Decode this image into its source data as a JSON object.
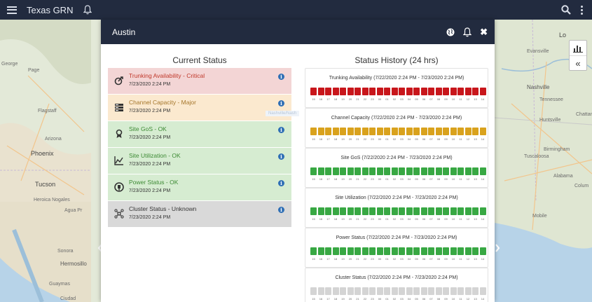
{
  "app": {
    "title": "Texas GRN"
  },
  "map": {
    "labels": [
      {
        "text": "Lo",
        "cls": "map-label big"
      },
      {
        "text": "Evansville",
        "cls": "map-label"
      },
      {
        "text": "Nashville",
        "cls": "map-label city"
      },
      {
        "text": "Tennessee",
        "cls": "map-label"
      },
      {
        "text": "Chattanoog",
        "cls": "map-label"
      },
      {
        "text": "Huntsville",
        "cls": "map-label"
      },
      {
        "text": "Birmingham",
        "cls": "map-label"
      },
      {
        "text": "Tuscaloosa",
        "cls": "map-label"
      },
      {
        "text": "Alabama",
        "cls": "map-label"
      },
      {
        "text": "Colum",
        "cls": "map-label"
      },
      {
        "text": "Mobile",
        "cls": "map-label"
      },
      {
        "text": "George",
        "cls": "map-label"
      },
      {
        "text": "Page",
        "cls": "map-label"
      },
      {
        "text": "Flagstaff",
        "cls": "map-label"
      },
      {
        "text": "Arizona",
        "cls": "map-label"
      },
      {
        "text": "Phoenix",
        "cls": "map-label big"
      },
      {
        "text": "Tucson",
        "cls": "map-label big"
      },
      {
        "text": "Heroica Nogales",
        "cls": "map-label"
      },
      {
        "text": "Agua Pr",
        "cls": "map-label"
      },
      {
        "text": "Sonora",
        "cls": "map-label"
      },
      {
        "text": "Hermosillo",
        "cls": "map-label city"
      },
      {
        "text": "Guaymas",
        "cls": "map-label"
      },
      {
        "text": "Ciudad",
        "cls": "map-label"
      }
    ]
  },
  "modal": {
    "title": "Austin",
    "current_status_title": "Current Status",
    "history_title": "Status History (24 hrs)",
    "ghost_text": "Nashville/Nash"
  },
  "statuses": [
    {
      "label": "Trunking Availability - Critical",
      "time": "7/23/2020 2:24 PM",
      "level": "critical",
      "icon": "trunking-icon"
    },
    {
      "label": "Channel Capacity - Major",
      "time": "7/23/2020 2:24 PM",
      "level": "major",
      "icon": "channel-capacity-icon"
    },
    {
      "label": "Site GoS - OK",
      "time": "7/23/2020 2:24 PM",
      "level": "ok",
      "icon": "site-gos-icon"
    },
    {
      "label": "Site Utilization - OK",
      "time": "7/23/2020 2:24 PM",
      "level": "ok",
      "icon": "site-utilization-icon"
    },
    {
      "label": "Power Status - OK",
      "time": "7/23/2020 2:24 PM",
      "level": "ok",
      "icon": "power-status-icon"
    },
    {
      "label": "Cluster Status - Unknown",
      "time": "7/23/2020 2:24 PM",
      "level": "unknown",
      "icon": "cluster-status-icon"
    }
  ],
  "history": [
    {
      "title": "Trunking Availability (7/22/2020 2:24 PM - 7/23/2020 2:24 PM)",
      "color": "#c8161b"
    },
    {
      "title": "Channel Capacity (7/22/2020 2:24 PM - 7/23/2020 2:24 PM)",
      "color": "#d9a21d"
    },
    {
      "title": "Site GoS (7/22/2020 2:24 PM - 7/23/2020 2:24 PM)",
      "color": "#38a843"
    },
    {
      "title": "Site Utilization (7/22/2020 2:24 PM - 7/23/2020 2:24 PM)",
      "color": "#38a843"
    },
    {
      "title": "Power Status (7/22/2020 2:24 PM - 7/23/2020 2:24 PM)",
      "color": "#38a843"
    },
    {
      "title": "Cluster Status (7/22/2020 2:24 PM - 7/23/2020 2:24 PM)",
      "color": "#d4d4d4"
    }
  ],
  "hour_ticks": [
    "15",
    "16",
    "17",
    "18",
    "19",
    "20",
    "21",
    "22",
    "23",
    "00",
    "01",
    "02",
    "03",
    "04",
    "05",
    "06",
    "07",
    "08",
    "09",
    "10",
    "11",
    "12",
    "13",
    "14"
  ],
  "colors": {
    "header": "#222b3f",
    "critical": "#c8161b",
    "major": "#d9a21d",
    "ok": "#38a843",
    "unknown": "#d4d4d4",
    "info": "#2f6fb5"
  }
}
